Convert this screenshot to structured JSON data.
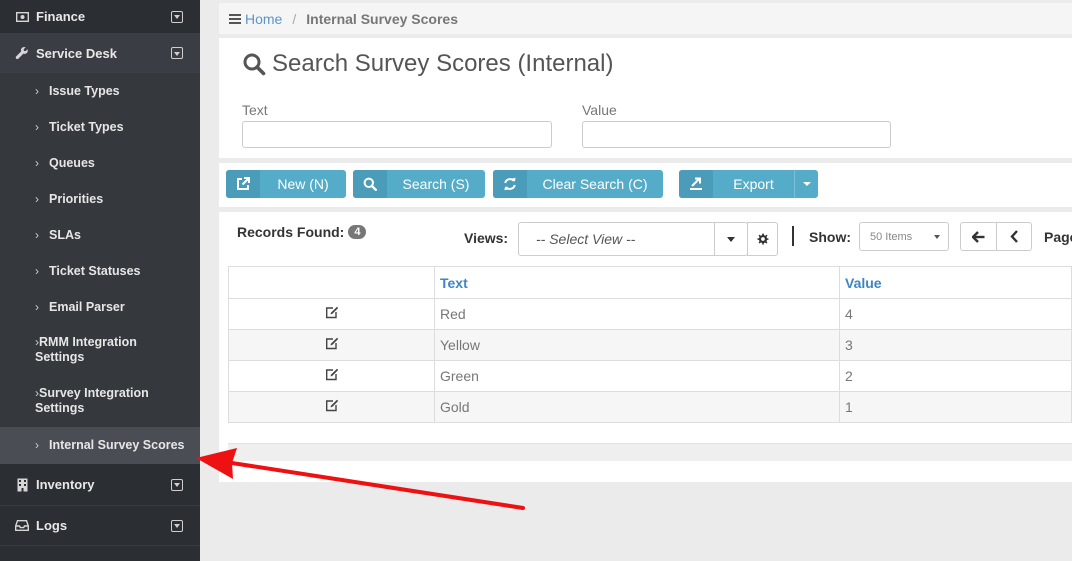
{
  "sidebar": {
    "finance": "Finance",
    "service_desk": "Service Desk",
    "items": [
      "Issue Types",
      "Ticket Types",
      "Queues",
      "Priorities",
      "SLAs",
      "Ticket Statuses",
      "Email Parser"
    ],
    "rmm_line1": "RMM Integration",
    "rmm_line2": "Settings",
    "survey_line1": "Survey Integration",
    "survey_line2": "Settings",
    "current_item": "Internal Survey Scores",
    "inventory": "Inventory",
    "logs": "Logs"
  },
  "breadcrumb": {
    "home": "Home",
    "separator": "/",
    "current": "Internal Survey Scores"
  },
  "search": {
    "title": "Search Survey Scores (Internal)",
    "text_label": "Text",
    "value_label": "Value",
    "text_value": "",
    "value_value": ""
  },
  "toolbar": {
    "new_label": "New (N)",
    "search_label": "Search (S)",
    "clear_label": "Clear Search (C)",
    "export_label": "Export"
  },
  "grid": {
    "records_label": "Records Found:",
    "records_count": "4",
    "views_label": "Views:",
    "select_view": "-- Select View --",
    "show_label": "Show:",
    "show_value": "50 Items",
    "page_label": "Page",
    "columns": [
      "Text",
      "Value"
    ],
    "rows": [
      {
        "text": "Red",
        "value": "4"
      },
      {
        "text": "Yellow",
        "value": "3"
      },
      {
        "text": "Green",
        "value": "2"
      },
      {
        "text": "Gold",
        "value": "1"
      }
    ]
  },
  "colors": {
    "sidebar_bg": "#2b2e33",
    "button": "#55acc9",
    "link": "#3e85c2",
    "annotation_arrow": "#ee1111"
  }
}
